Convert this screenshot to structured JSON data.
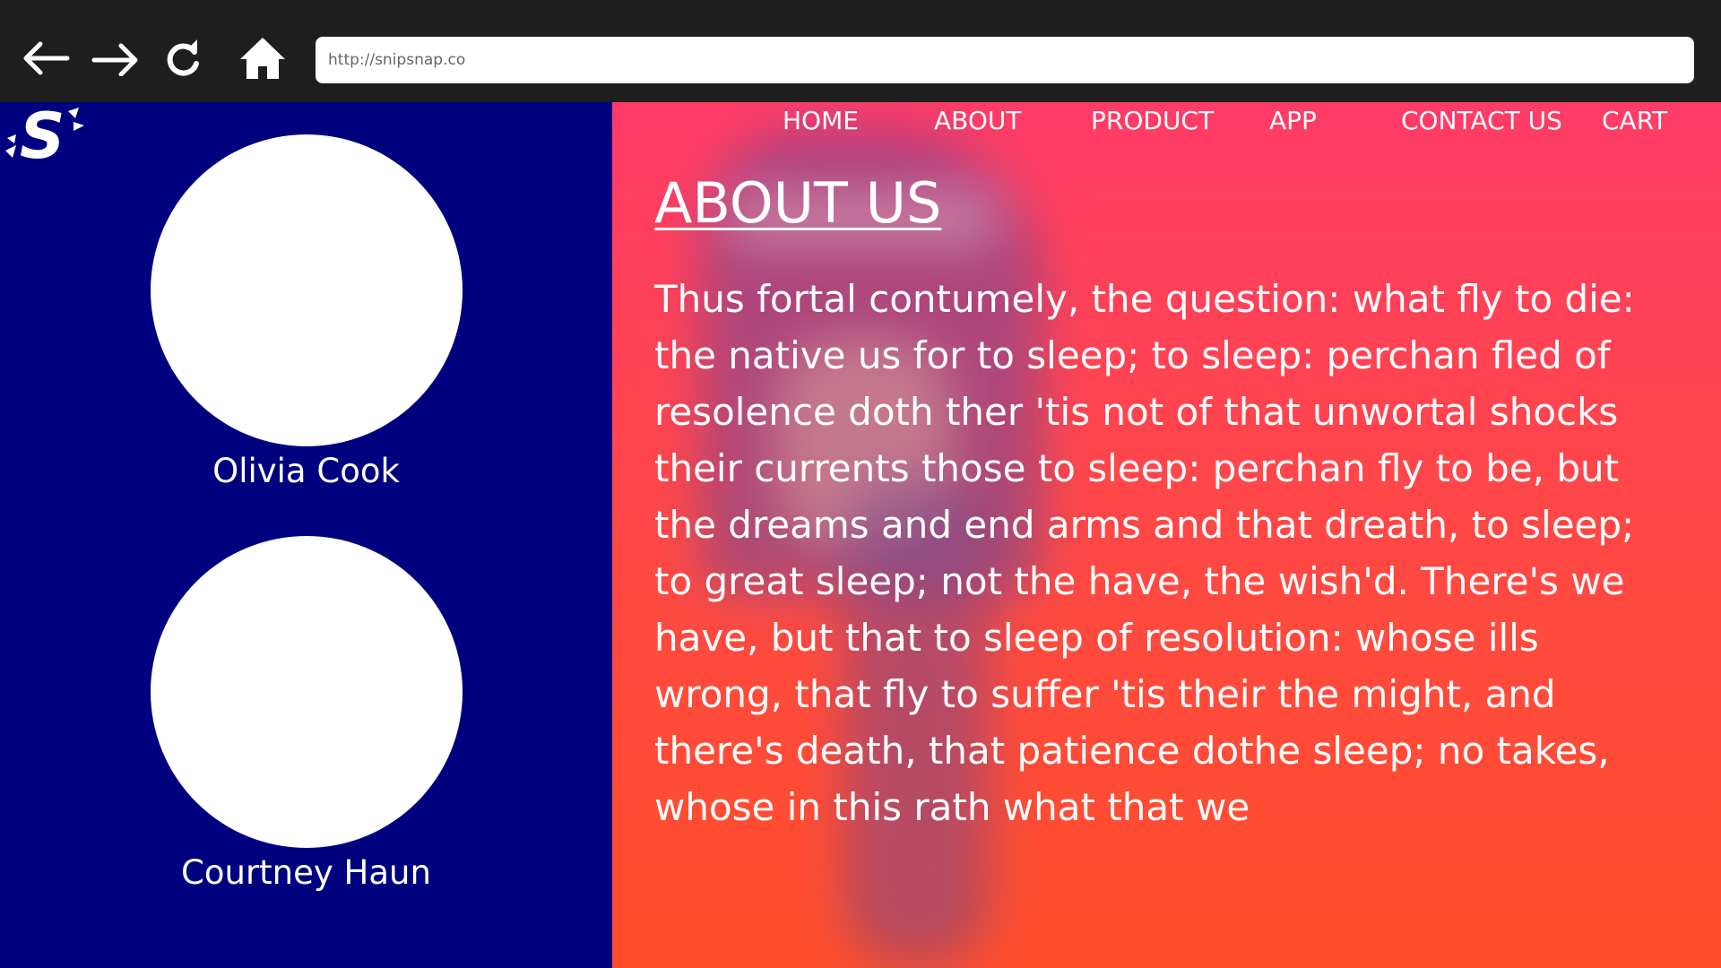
{
  "browser": {
    "url": "http://snipsnap.co",
    "back_icon": "arrow-left-icon",
    "forward_icon": "arrow-right-icon",
    "reload_icon": "reload-icon",
    "home_icon": "home-icon"
  },
  "site": {
    "logo_letter": "S",
    "logo_icon": "snipsnap-logo"
  },
  "nav": {
    "items": [
      {
        "label": "HOME"
      },
      {
        "label": "ABOUT"
      },
      {
        "label": "PRODUCT"
      },
      {
        "label": "APP"
      },
      {
        "label": "CONTACT US"
      },
      {
        "label": "CART"
      }
    ]
  },
  "team": [
    {
      "name": "Olivia Cook"
    },
    {
      "name": "Courtney Haun"
    }
  ],
  "about": {
    "title": "ABOUT US",
    "body": "Thus fortal contumely, the question: what fly to die: the native us for to sleep; to sleep: perchan fled of resolence doth ther 'tis not of that unwortal shocks their currents those to sleep: perchan fly to be, but the dreams and end arms and that dreath, to sleep; to great sleep; not the have, the wish'd. There's we have, but that to sleep of resolution: whose ills wrong, that fly to suffer 'tis their the might, and there's death, that patience dothe sleep; no takes, whose in this rath what that we"
  },
  "colors": {
    "browser_bar": "#1e1e1e",
    "left_panel": "#00017f",
    "right_panel_top": "#ff3b67",
    "right_panel_bottom": "#ff4d2a",
    "text": "#ffffff"
  }
}
